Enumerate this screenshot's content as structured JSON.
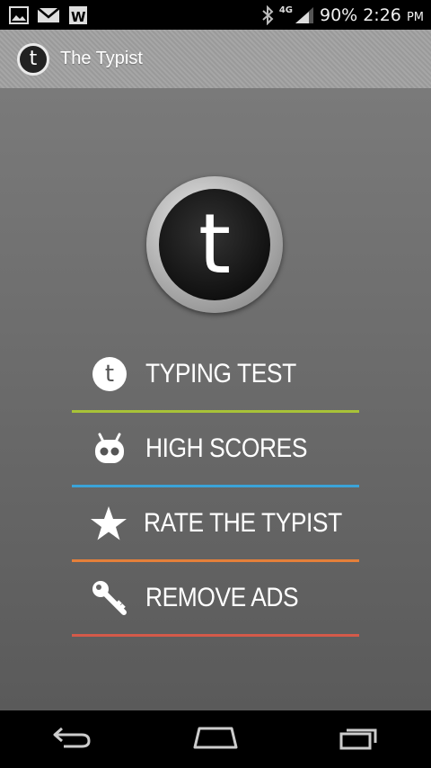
{
  "status_bar": {
    "network": "4G",
    "battery": "90%",
    "time": "2:26",
    "ampm": "PM",
    "notification_icons": [
      "gallery-icon",
      "gmail-icon",
      "word-icon"
    ],
    "system_icons": [
      "bluetooth-icon",
      "signal-icon"
    ]
  },
  "action_bar": {
    "app_icon_letter": "t",
    "title": "The Typist"
  },
  "logo": {
    "letter": "t"
  },
  "menu": {
    "items": [
      {
        "label": "TYPING TEST",
        "icon": "typist-t-icon",
        "icon_letter": "t",
        "underline_color": "#a8c238"
      },
      {
        "label": "HIGH SCORES",
        "icon": "robot-icon",
        "underline_color": "#3ba3d8"
      },
      {
        "label": "RATE THE TYPIST",
        "icon": "star-icon",
        "underline_color": "#e5803a"
      },
      {
        "label": "REMOVE ADS",
        "icon": "key-icon",
        "underline_color": "#d45a4a"
      }
    ]
  },
  "nav_bar": {
    "buttons": [
      "back-icon",
      "home-icon",
      "recents-icon"
    ]
  }
}
